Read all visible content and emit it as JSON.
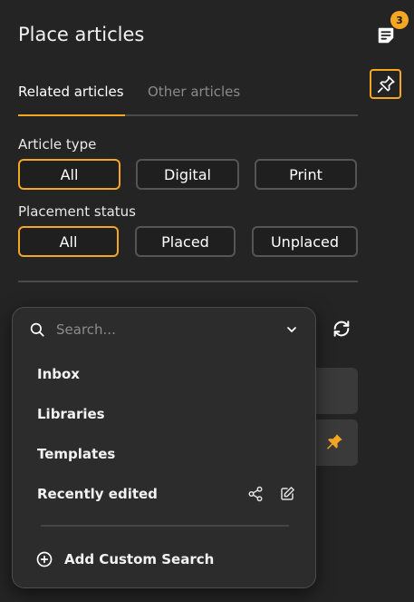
{
  "panel": {
    "title": "Place articles",
    "notification_count": "3"
  },
  "tabs": [
    {
      "label": "Related articles",
      "active": true
    },
    {
      "label": "Other articles",
      "active": false
    }
  ],
  "filters": {
    "article_type": {
      "label": "Article type",
      "options": [
        "All",
        "Digital",
        "Print"
      ],
      "selected": "All"
    },
    "placement_status": {
      "label": "Placement status",
      "options": [
        "All",
        "Placed",
        "Unplaced"
      ],
      "selected": "All"
    }
  },
  "search": {
    "placeholder": "Search...",
    "value": "",
    "items": [
      {
        "label": "Inbox"
      },
      {
        "label": "Libraries"
      },
      {
        "label": "Templates"
      },
      {
        "label": "Recently edited"
      }
    ],
    "add_label": "Add Custom Search"
  },
  "colors": {
    "accent": "#f5a623",
    "background": "#242424",
    "dropdown_bg": "#2c2c2c"
  },
  "icons": [
    "notes-icon",
    "pin-icon",
    "refresh-icon",
    "search-icon",
    "chevron-down-icon",
    "share-icon",
    "edit-icon",
    "add-circle-icon"
  ]
}
